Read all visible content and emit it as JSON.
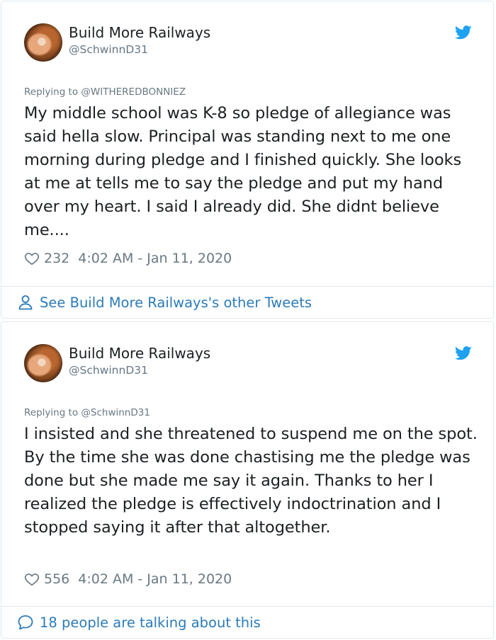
{
  "colors": {
    "link_blue": "#2b7bb9",
    "twitter_blue": "#1da1f2",
    "muted_text": "#697882",
    "body_text": "#1c2022",
    "border": "#e1e8ed"
  },
  "tweets": [
    {
      "author_name": "Build More Railways",
      "author_handle": "@SchwinnD31",
      "reply_label": "Replying to @WITHEREDBONNIEZ",
      "text": "My middle school was K-8 so pledge of allegiance was said hella slow. Principal was standing next to me one morning during pledge and I finished quickly. She looks at me at tells me to say the pledge and put my hand over my heart. I said I already did. She didnt believe me....",
      "likes": "232",
      "timestamp": "4:02 AM - Jan 11, 2020",
      "footer_icon": "person-icon",
      "footer_text": "See Build More Railways's other Tweets"
    },
    {
      "author_name": "Build More Railways",
      "author_handle": "@SchwinnD31",
      "reply_label": "Replying to @SchwinnD31",
      "text": "I insisted and she threatened to suspend me on the spot. By the time she was done chastising me the pledge was done but she made me say it again. Thanks to her I realized the pledge is effectively indoctrination and I stopped saying it after that altogether.",
      "likes": "556",
      "timestamp": "4:02 AM - Jan 11, 2020",
      "footer_icon": "speech-bubble-icon",
      "footer_text": "18 people are talking about this"
    }
  ]
}
